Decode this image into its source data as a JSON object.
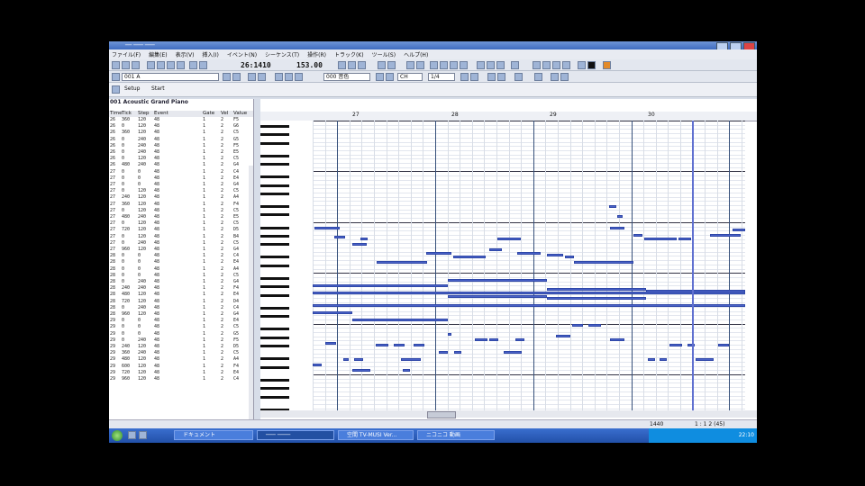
{
  "window": {
    "title": "── ─── ───"
  },
  "menu": [
    "ファイル(F)",
    "編集(E)",
    "表示(V)",
    "挿入(I)",
    "イベント(N)",
    "シーケンス(T)",
    "操作(R)",
    "トラック(K)",
    "ツール(S)",
    "ヘルプ(H)"
  ],
  "toolbar": {
    "position": "26:1410",
    "tempo": "153.00",
    "instrument": "001 A",
    "field2": "000 音色",
    "field3": "CH",
    "field4": "1/4"
  },
  "setup": {
    "setup_label": "Setup",
    "start_label": "Start"
  },
  "track": {
    "name": "001 Acoustic Grand Piano"
  },
  "event_columns": [
    "Time",
    "Tick",
    "Step",
    "Event",
    "Gate",
    "Vel",
    "Value"
  ],
  "events": [
    [
      "26",
      "360",
      "120",
      "48",
      "1",
      "2",
      "F5"
    ],
    [
      "26",
      "0",
      "120",
      "48",
      "1",
      "2",
      "G6"
    ],
    [
      "26",
      "360",
      "120",
      "48",
      "1",
      "2",
      "C5"
    ],
    [
      "26",
      "0",
      "240",
      "48",
      "1",
      "2",
      "G5"
    ],
    [
      "26",
      "0",
      "240",
      "48",
      "1",
      "2",
      "F5"
    ],
    [
      "26",
      "0",
      "240",
      "48",
      "1",
      "2",
      "E5"
    ],
    [
      "26",
      "0",
      "120",
      "48",
      "1",
      "2",
      "C5"
    ],
    [
      "26",
      "480",
      "240",
      "48",
      "1",
      "2",
      "G4"
    ],
    [
      "27",
      "0",
      "0",
      "48",
      "1",
      "2",
      "C4"
    ],
    [
      "27",
      "0",
      "0",
      "48",
      "1",
      "2",
      "E4"
    ],
    [
      "27",
      "0",
      "0",
      "48",
      "1",
      "2",
      "G4"
    ],
    [
      "27",
      "0",
      "120",
      "48",
      "1",
      "2",
      "C5"
    ],
    [
      "27",
      "240",
      "120",
      "48",
      "1",
      "2",
      "A4"
    ],
    [
      "27",
      "360",
      "120",
      "48",
      "1",
      "2",
      "F4"
    ],
    [
      "27",
      "0",
      "120",
      "48",
      "1",
      "2",
      "C5"
    ],
    [
      "27",
      "480",
      "240",
      "48",
      "1",
      "2",
      "E5"
    ],
    [
      "27",
      "0",
      "120",
      "48",
      "1",
      "2",
      "C5"
    ],
    [
      "27",
      "720",
      "120",
      "48",
      "1",
      "2",
      "D5"
    ],
    [
      "27",
      "0",
      "120",
      "48",
      "1",
      "2",
      "B4"
    ],
    [
      "27",
      "0",
      "240",
      "48",
      "1",
      "2",
      "C5"
    ],
    [
      "27",
      "960",
      "120",
      "48",
      "1",
      "2",
      "G4"
    ],
    [
      "28",
      "0",
      "0",
      "48",
      "1",
      "2",
      "C4"
    ],
    [
      "28",
      "0",
      "0",
      "48",
      "1",
      "2",
      "E4"
    ],
    [
      "28",
      "0",
      "0",
      "48",
      "1",
      "2",
      "A4"
    ],
    [
      "28",
      "0",
      "0",
      "48",
      "1",
      "2",
      "C5"
    ],
    [
      "28",
      "0",
      "240",
      "48",
      "1",
      "2",
      "G4"
    ],
    [
      "28",
      "240",
      "240",
      "48",
      "1",
      "2",
      "F4"
    ],
    [
      "28",
      "480",
      "120",
      "48",
      "1",
      "2",
      "E4"
    ],
    [
      "28",
      "720",
      "120",
      "48",
      "1",
      "2",
      "D4"
    ],
    [
      "28",
      "0",
      "240",
      "48",
      "1",
      "2",
      "C4"
    ],
    [
      "28",
      "960",
      "120",
      "48",
      "1",
      "2",
      "G4"
    ],
    [
      "29",
      "0",
      "0",
      "48",
      "1",
      "2",
      "E4"
    ],
    [
      "29",
      "0",
      "0",
      "48",
      "1",
      "2",
      "C5"
    ],
    [
      "29",
      "0",
      "0",
      "48",
      "1",
      "2",
      "G5"
    ],
    [
      "29",
      "0",
      "240",
      "48",
      "1",
      "2",
      "F5"
    ],
    [
      "29",
      "240",
      "120",
      "48",
      "1",
      "2",
      "D5"
    ],
    [
      "29",
      "360",
      "240",
      "48",
      "1",
      "2",
      "C5"
    ],
    [
      "29",
      "480",
      "120",
      "48",
      "1",
      "2",
      "A4"
    ],
    [
      "29",
      "600",
      "120",
      "48",
      "1",
      "2",
      "F4"
    ],
    [
      "29",
      "720",
      "120",
      "48",
      "1",
      "2",
      "E4"
    ],
    [
      "29",
      "960",
      "120",
      "48",
      "1",
      "2",
      "C4"
    ]
  ],
  "ruler": [
    "27",
    "28",
    "29",
    "30"
  ],
  "status": {
    "left": "1440",
    "right": "1 : 1 2 (45)"
  },
  "taskbar": {
    "items": [
      "ドキュメント",
      "─── ────",
      "空間 TV-MUSI Ver...",
      "ニコニコ 動画"
    ],
    "clock": "22:10"
  },
  "colors": {
    "note": "#4a63c8",
    "taskbar": "#2250a8",
    "titlebar": "#3f6cc0"
  }
}
